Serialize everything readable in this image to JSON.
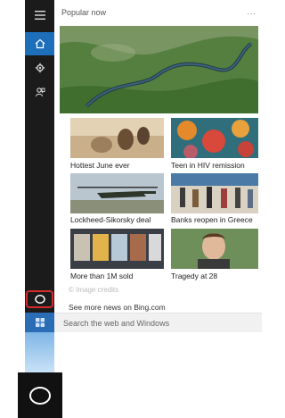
{
  "panel": {
    "section_title": "Popular now",
    "more": "...",
    "hero_alt": "",
    "news": [
      {
        "caption": "Hottest June ever"
      },
      {
        "caption": "Teen in HIV remission"
      },
      {
        "caption": "Lockheed-Sikorsky deal"
      },
      {
        "caption": "Banks reopen in Greece"
      },
      {
        "caption": "More than 1M sold"
      },
      {
        "caption": "Tragedy at 28"
      }
    ],
    "credits": "© Image credits",
    "see_more": "See more news on Bing.com"
  },
  "search": {
    "placeholder": "Search the web and Windows"
  },
  "rail": {
    "items": [
      "hamburger-icon",
      "home-icon",
      "settings-icon",
      "feedback-icon"
    ],
    "active": "home-icon",
    "accent": "#1e6fb9",
    "highlight_color": "#d42b2b"
  }
}
